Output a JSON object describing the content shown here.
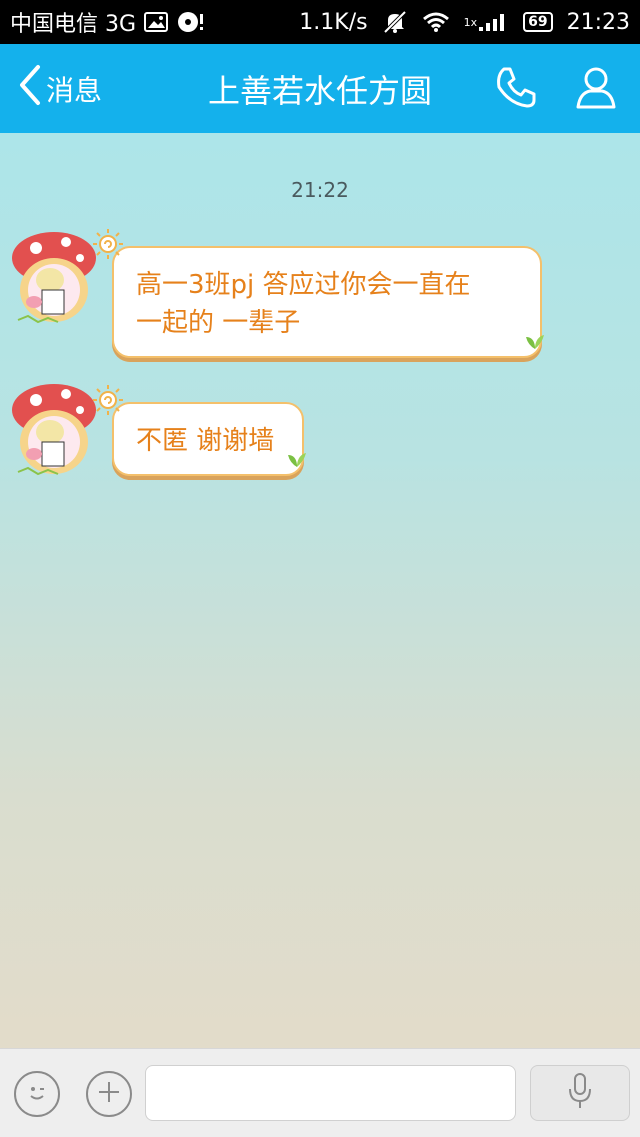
{
  "status_bar": {
    "carrier": "中国电信 3G",
    "speed": "1.1K/s",
    "signal_label": "1x",
    "battery": "69",
    "time": "21:23"
  },
  "header": {
    "back_label": "消息",
    "title": "上善若水任方圆"
  },
  "chat": {
    "timestamp": "21:22",
    "messages": [
      {
        "line1": "高一3班pj 答应过你会一直在",
        "line2": "一起的 一辈子"
      },
      {
        "line1": "不匿 谢谢墙"
      }
    ]
  },
  "input_bar": {
    "placeholder": ""
  },
  "colors": {
    "header_bg": "#14b1ec",
    "bubble_text": "#e6811b",
    "bubble_border": "#f4c06b"
  },
  "icons": [
    "image-icon",
    "music-icon",
    "mute-icon",
    "wifi-icon",
    "signal-icon",
    "back-chevron-icon",
    "phone-icon",
    "profile-icon",
    "emoji-icon",
    "plus-icon",
    "microphone-icon"
  ]
}
